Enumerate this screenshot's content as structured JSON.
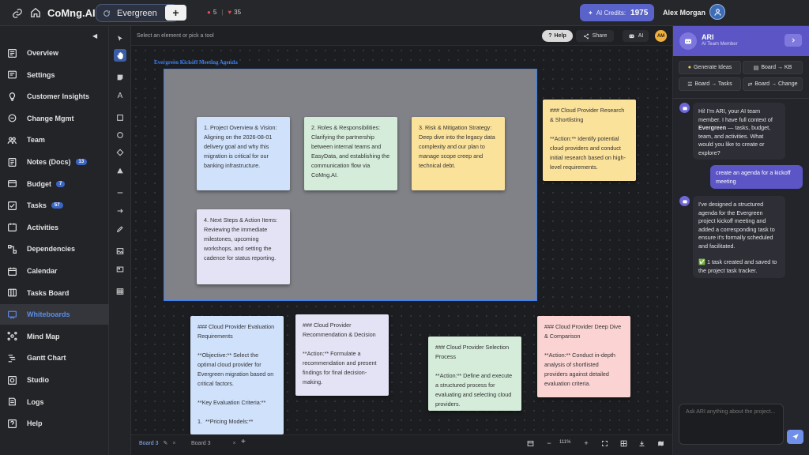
{
  "header": {
    "brand": "CoMng.AI",
    "project": "Evergreen",
    "add_label": "+",
    "stat_alerts": "5",
    "stat_likes": "35",
    "credits_label": "AI Credits:",
    "credits_value": "1975",
    "user_name": "Alex Morgan"
  },
  "sidebar": {
    "collapse": "◀",
    "items": [
      {
        "label": "Overview",
        "icon": "overview-icon"
      },
      {
        "label": "Settings",
        "icon": "settings-icon"
      },
      {
        "label": "Customer Insights",
        "icon": "bulb-icon"
      },
      {
        "label": "Change Mgmt",
        "icon": "change-icon"
      },
      {
        "label": "Team",
        "icon": "team-icon"
      },
      {
        "label": "Notes (Docs)",
        "icon": "notes-icon",
        "badge": "13"
      },
      {
        "label": "Budget",
        "icon": "budget-icon",
        "badge": "7"
      },
      {
        "label": "Tasks",
        "icon": "tasks-icon",
        "badge": "57"
      },
      {
        "label": "Activities",
        "icon": "activities-icon"
      },
      {
        "label": "Dependencies",
        "icon": "dependencies-icon"
      },
      {
        "label": "Calendar",
        "icon": "calendar-icon"
      },
      {
        "label": "Tasks Board",
        "icon": "tasks-board-icon"
      },
      {
        "label": "Whiteboards",
        "icon": "whiteboard-icon",
        "active": true
      },
      {
        "label": "Mind Map",
        "icon": "mindmap-icon"
      },
      {
        "label": "Gantt Chart",
        "icon": "gantt-icon"
      },
      {
        "label": "Studio",
        "icon": "studio-icon"
      },
      {
        "label": "Logs",
        "icon": "logs-icon"
      },
      {
        "label": "Help",
        "icon": "help-icon"
      }
    ]
  },
  "canvas_bar": {
    "hint": "Select an element or pick a tool",
    "help": "Help",
    "share": "Share",
    "ai": "AI",
    "avatar": "AM"
  },
  "whiteboard": {
    "frame_title": "Evergreen Kickoff Meeting Agenda",
    "notes": [
      {
        "text": "1. Project Overview & Vision: Aligning on the 2026-08-01 delivery goal and why this migration is critical for our banking infrastructure.",
        "color": "#cfe1fb"
      },
      {
        "text": "2. Roles & Responsibilities: Clarifying the partnership between internal teams and EasyData, and establishing the communication flow via CoMng.AI.",
        "color": "#d4ecd9"
      },
      {
        "text": "3. Risk & Mitigation Strategy: Deep dive into the legacy data complexity and our plan to manage scope creep and technical debt.",
        "color": "#fbe29b"
      },
      {
        "text": "4. Next Steps & Action Items: Reviewing the immediate milestones, upcoming workshops, and setting the cadence for status reporting.",
        "color": "#e3e3f5"
      },
      {
        "text": "### Cloud Provider Research & Shortlisting\n\n**Action:** Identify potential cloud providers and conduct initial research based on high-level requirements.",
        "color": "#fbe29b"
      },
      {
        "text": "### Cloud Provider Evaluation Requirements\n\n**Objective:** Select the optimal cloud provider for Evergreen migration based on critical factors.\n\n**Key Evaluation Criteria:**\n\n1.  **Pricing Models:**",
        "color": "#cfe1fb"
      },
      {
        "text": "### Cloud Provider Recommendation & Decision\n\n**Action:** Formulate a recommendation and present findings for final decision-making.",
        "color": "#e3e3f5"
      },
      {
        "text": "### Cloud Provider Selection Process\n\n**Action:** Define and execute a structured process for evaluating and selecting cloud providers.",
        "color": "#d4ecd9"
      },
      {
        "text": "### Cloud Provider Deep Dive & Comparison\n\n**Action:** Conduct in-depth analysis of shortlisted providers against detailed evaluation criteria.",
        "color": "#fbd3d3"
      }
    ]
  },
  "tabs": {
    "items": [
      {
        "label": "Board 3"
      },
      {
        "label": "Board 3"
      }
    ],
    "close": "×",
    "add": "+",
    "zoom": "111%",
    "zoom_out": "−",
    "zoom_in": "+"
  },
  "ari": {
    "name": "ARI",
    "subtitle": "AI Team Member",
    "actions": [
      "Generate Ideas",
      "Board → KB",
      "Board → Tasks",
      "Board → Change"
    ],
    "messages": [
      {
        "from": "bot",
        "pre": "Hi! I'm ARI, your AI team member. I have full context of ",
        "bold": "Evergreen",
        "post": " — tasks, budget, team, and activities. What would you like to create or explore?"
      },
      {
        "from": "user",
        "text": "create an agenda for a kickoff meeting"
      },
      {
        "from": "bot",
        "text": "I've designed a structured agenda for the Evergreen project kickoff meeting and added a corresponding task to ensure it's formally scheduled and facilitated.",
        "extra": "✅ 1 task created and saved to the project task tracker."
      }
    ],
    "input_placeholder": "Ask ARI anything about the project..."
  }
}
